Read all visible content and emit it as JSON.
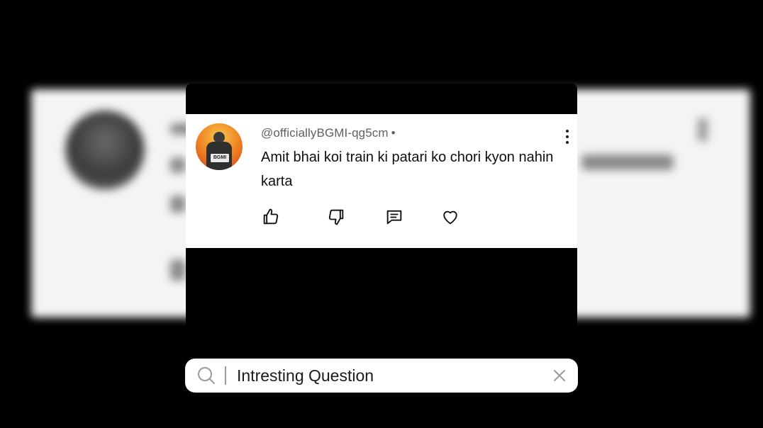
{
  "comment": {
    "username": "@officiallyBGMI-qg5cm",
    "separator": "•",
    "text": "Amit bhai koi train ki patari ko chori kyon nahin karta",
    "avatar_badge": "BGMI"
  },
  "actions": {
    "like_icon": "thumbs-up-icon",
    "dislike_icon": "thumbs-down-icon",
    "reply_icon": "comment-icon",
    "heart_icon": "heart-icon"
  },
  "search": {
    "value": "Intresting Question",
    "search_icon": "search-icon",
    "clear_icon": "close-icon"
  },
  "colors": {
    "background": "#000000",
    "card": "#ffffff",
    "username": "#606060",
    "text": "#0f0f0f"
  }
}
